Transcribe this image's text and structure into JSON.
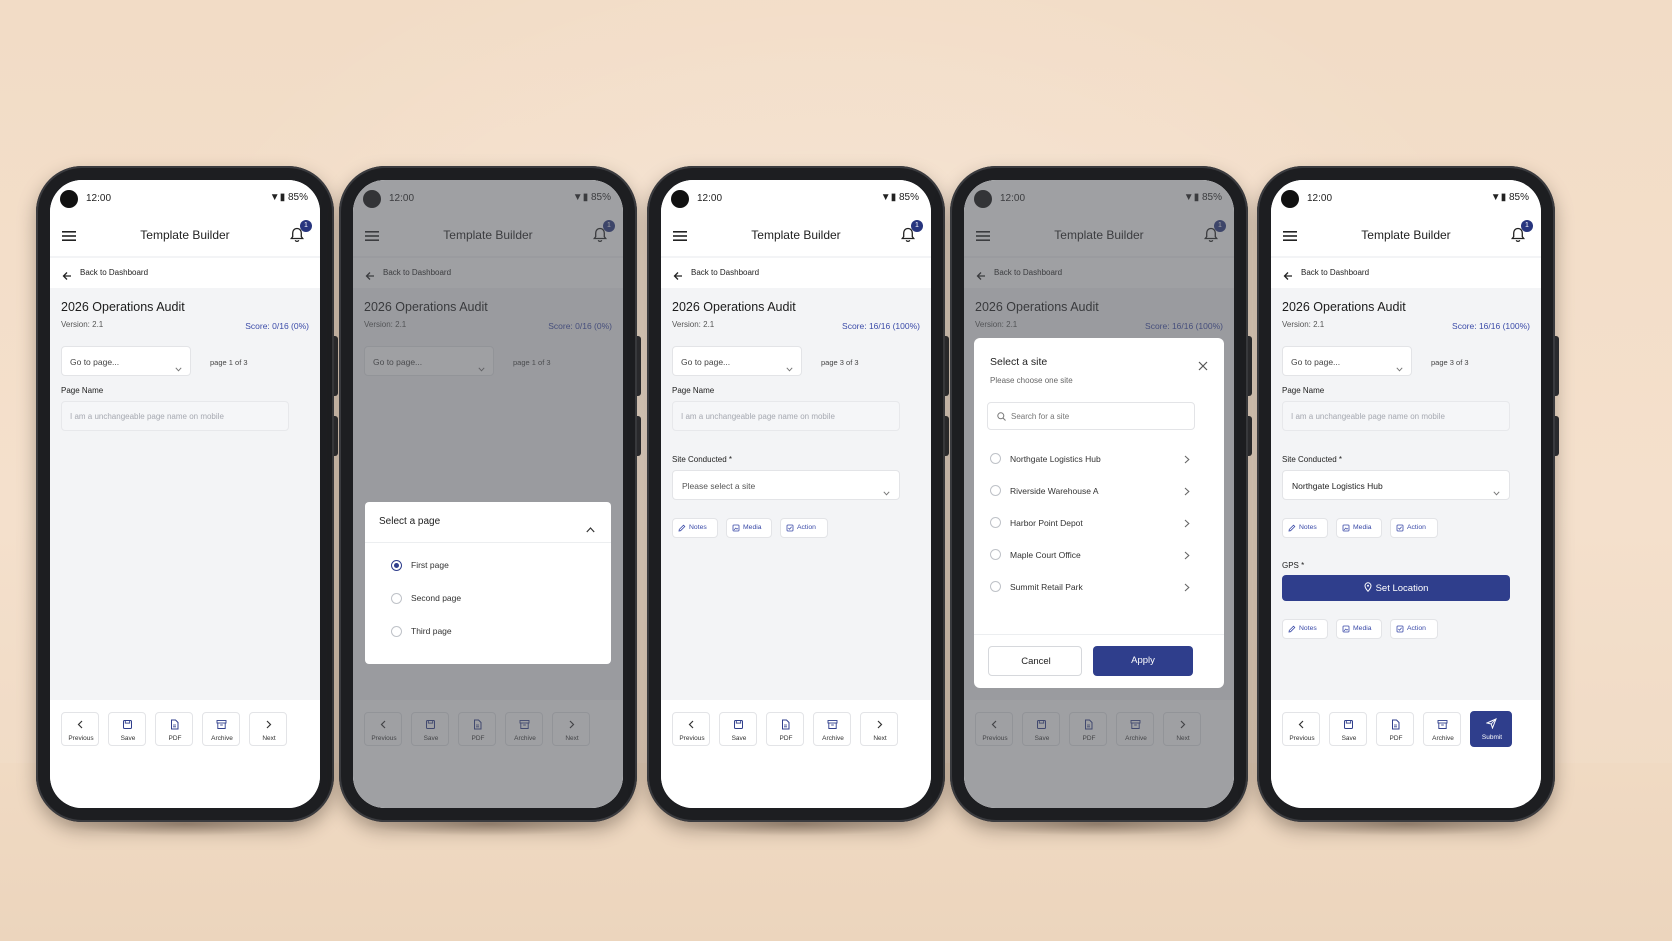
{
  "status": {
    "time": "12:00",
    "battery": "85%"
  },
  "appbar": {
    "title": "Template Builder",
    "notifications": "1"
  },
  "back_label": "Back to Dashboard",
  "audit": {
    "title": "2026 Operations Audit",
    "version": "Version: 2.1"
  },
  "score": {
    "zero": "Score: 0/16 (0%)",
    "full": "Score: 16/16 (100%)"
  },
  "goto_placeholder": "Go to page...",
  "page_of": {
    "first": "page 1 of 3",
    "third": "page 3 of 3"
  },
  "page_name": {
    "label": "Page Name",
    "placeholder": "I am a unchangeable page name on mobile"
  },
  "site_conducted": {
    "label": "Site Conducted *",
    "placeholder": "Please select a site",
    "value": "Northgate Logistics Hub"
  },
  "chips": {
    "notes": "Notes",
    "media": "Media",
    "action": "Action"
  },
  "gps": {
    "label": "GPS *",
    "button": "Set Location"
  },
  "nav": {
    "previous": "Previous",
    "save": "Save",
    "pdf": "PDF",
    "archive": "Archive",
    "next": "Next",
    "submit": "Submit"
  },
  "page_select": {
    "title": "Select a page",
    "options": [
      {
        "label": "First page",
        "selected": true
      },
      {
        "label": "Second page",
        "selected": false
      },
      {
        "label": "Third page",
        "selected": false
      }
    ]
  },
  "site_select": {
    "title": "Select a site",
    "subtitle": "Please choose one site",
    "search_placeholder": "Search for a site",
    "sites": [
      "Northgate Logistics Hub",
      "Riverside Warehouse A",
      "Harbor Point Depot",
      "Maple Court Office",
      "Summit Retail Park"
    ],
    "cancel": "Cancel",
    "apply": "Apply"
  },
  "colors": {
    "brand": "#2f3e8c",
    "score_text": "#3a4aa8",
    "backdrop": "#f2dcc6"
  }
}
